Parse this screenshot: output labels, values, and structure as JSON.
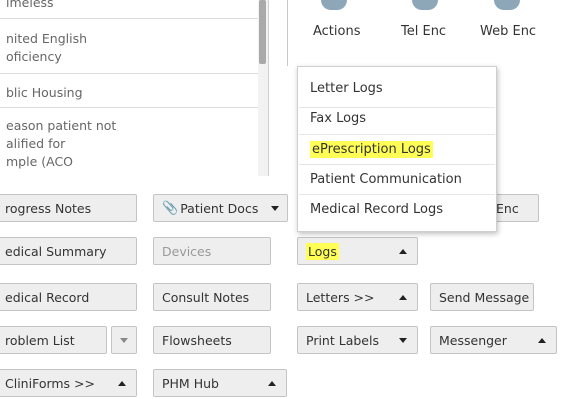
{
  "left_list": {
    "items": [
      {
        "label": "ımeless"
      },
      {
        "label": "nited English"
      },
      {
        "label": "oficiency"
      },
      {
        "label": "blic Housing"
      },
      {
        "label": "eason patient not"
      },
      {
        "label": "alified for"
      },
      {
        "label": "mple (ACO"
      }
    ]
  },
  "actions": {
    "items": [
      {
        "label": "Actions",
        "icon": "actions-icon"
      },
      {
        "label": "Tel Enc",
        "icon": "tel-enc-icon"
      },
      {
        "label": "Web Enc",
        "icon": "web-enc-icon"
      }
    ]
  },
  "logs_menu": {
    "items": [
      {
        "label": "Letter Logs",
        "highlighted": false
      },
      {
        "label": "Fax Logs",
        "highlighted": false
      },
      {
        "label": "ePrescription Logs",
        "highlighted": true
      },
      {
        "label": "Patient Communication",
        "highlighted": false
      },
      {
        "label": "Medical Record Logs",
        "highlighted": false
      }
    ]
  },
  "buttons": {
    "progress_notes": "rogress Notes",
    "patient_docs": "Patient Docs",
    "enc_partial": "Enc",
    "medical_summary": "edical Summary",
    "devices": "Devices",
    "logs": "Logs",
    "medical_record": "edical Record",
    "consult_notes": "Consult Notes",
    "letters": "Letters  >>",
    "send_message": "Send Message",
    "problem_list": "roblem List",
    "flowsheets": "Flowsheets",
    "print_labels": "Print Labels",
    "messenger": "Messenger",
    "cliniforms": "CliniForms  >>",
    "phm_hub": "PHM Hub"
  },
  "colors": {
    "highlight": "#ffff55",
    "button_bg": "#eeeeee",
    "icon_circle": "#8da7b8"
  }
}
